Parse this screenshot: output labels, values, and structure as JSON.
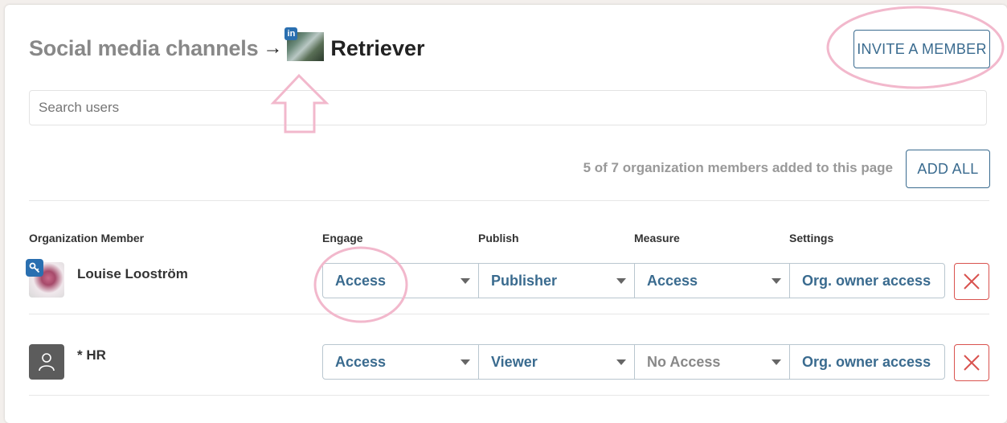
{
  "header": {
    "breadcrumb": "Social media channels",
    "arrow": "→",
    "channel_network": "in",
    "channel_name": "Retriever",
    "invite_label": "INVITE A MEMBER"
  },
  "search": {
    "placeholder": "Search users"
  },
  "summary": {
    "count_text": "5 of 7 organization members added to this page",
    "add_all_label": "ADD ALL"
  },
  "columns": {
    "member": "Organization Member",
    "engage": "Engage",
    "publish": "Publish",
    "measure": "Measure",
    "settings": "Settings"
  },
  "members": [
    {
      "name": "Louise Looström",
      "engage": "Access",
      "publish": "Publisher",
      "measure": "Access",
      "settings": "Org. owner access"
    },
    {
      "name": "* HR",
      "engage": "Access",
      "publish": "Viewer",
      "measure": "No Access",
      "settings": "Org. owner access"
    }
  ],
  "colors": {
    "accent": "#3a6b8f",
    "danger": "#d9534f",
    "highlight": "#f2b8cc",
    "linkedin": "#2a6fb0"
  }
}
